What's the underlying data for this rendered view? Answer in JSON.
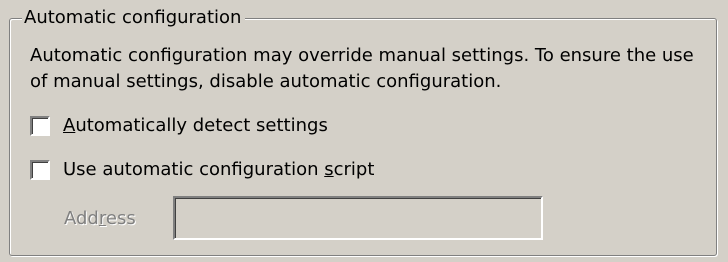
{
  "groupbox": {
    "title": "Automatic configuration",
    "description": "Automatic configuration may override manual settings.  To ensure the use of manual settings, disable automatic configuration."
  },
  "options": {
    "auto_detect": {
      "label_pre": "",
      "label_key": "A",
      "label_post": "utomatically detect settings",
      "checked": false
    },
    "auto_script": {
      "label_pre": "Use automatic configuration ",
      "label_key": "s",
      "label_post": "cript",
      "checked": false
    }
  },
  "address": {
    "label_pre": "Add",
    "label_key": "r",
    "label_post": "ess",
    "value": "",
    "enabled": false
  }
}
